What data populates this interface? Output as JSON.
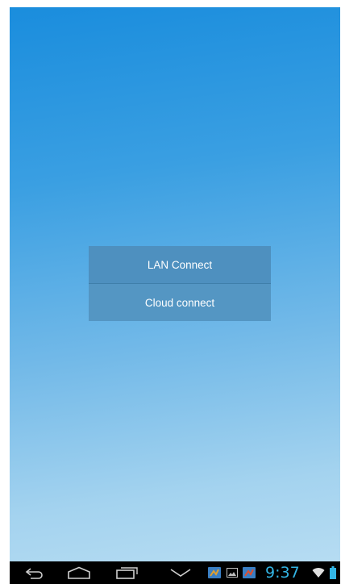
{
  "main": {
    "lan_button_label": "LAN Connect",
    "cloud_button_label": "Cloud connect"
  },
  "navbar": {
    "icons": [
      "back-icon",
      "home-icon",
      "recent-apps-icon",
      "collapse-chevron-icon"
    ],
    "status_icons": [
      "app-notification-icon",
      "image-notification-icon",
      "app-notification-icon",
      "wifi-icon",
      "battery-icon"
    ],
    "time": "9:37"
  },
  "colors": {
    "background_top": "#1a8ddd",
    "background_bottom": "#b6dcf2",
    "button": "#4e90bf",
    "navbar": "#000000",
    "accent": "#33b5e5"
  }
}
